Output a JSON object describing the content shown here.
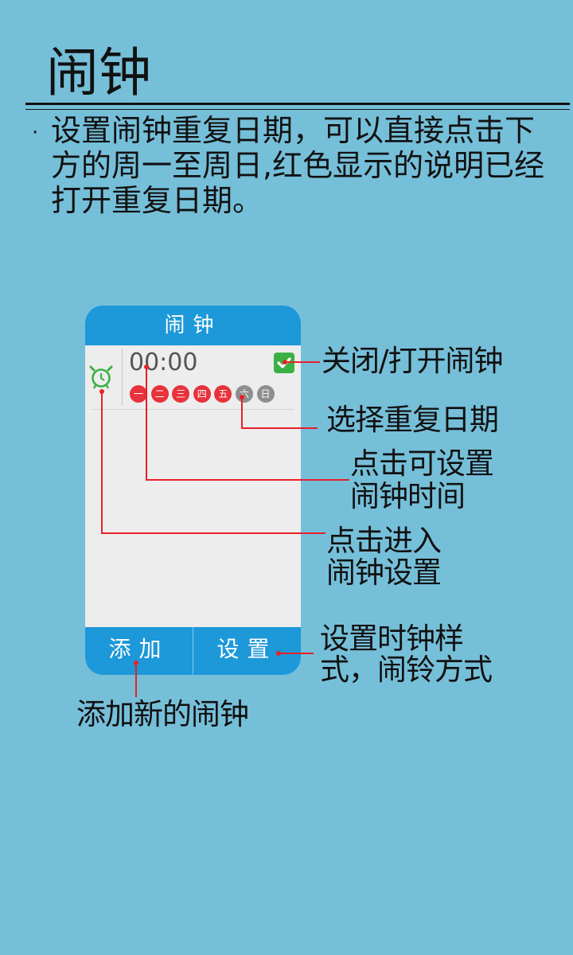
{
  "page": {
    "title": "闹钟",
    "bullet": "·",
    "description": "设置闹钟重复日期，可以直接点击下方的周一至周日,红色显示的说明已经打开重复日期。"
  },
  "phone": {
    "header_title": "闹钟",
    "alarm": {
      "time": "00:00",
      "enabled": true,
      "days": [
        {
          "label": "一",
          "on": true
        },
        {
          "label": "二",
          "on": true
        },
        {
          "label": "三",
          "on": true
        },
        {
          "label": "四",
          "on": true
        },
        {
          "label": "五",
          "on": true
        },
        {
          "label": "六",
          "on": false
        },
        {
          "label": "日",
          "on": false
        }
      ]
    },
    "footer": {
      "add_label": "添加",
      "settings_label": "设置"
    }
  },
  "annotations": {
    "toggle": "关闭/打开闹钟",
    "repeat_days": "选择重复日期",
    "set_time_line1": "点击可设置",
    "set_time_line2": "闹钟时间",
    "enter_settings_line1": "点击进入",
    "enter_settings_line2": "闹钟设置",
    "clock_style_line1": "设置时钟样",
    "clock_style_line2": "式，闹铃方式",
    "add_new": "添加新的闹钟"
  },
  "colors": {
    "background": "#76bfd9",
    "phone_blue": "#1d98d9",
    "day_on": "#e8323c",
    "day_off": "#8e8e8e",
    "toggle_green": "#3cb043",
    "annotation_red": "#e8202a"
  }
}
